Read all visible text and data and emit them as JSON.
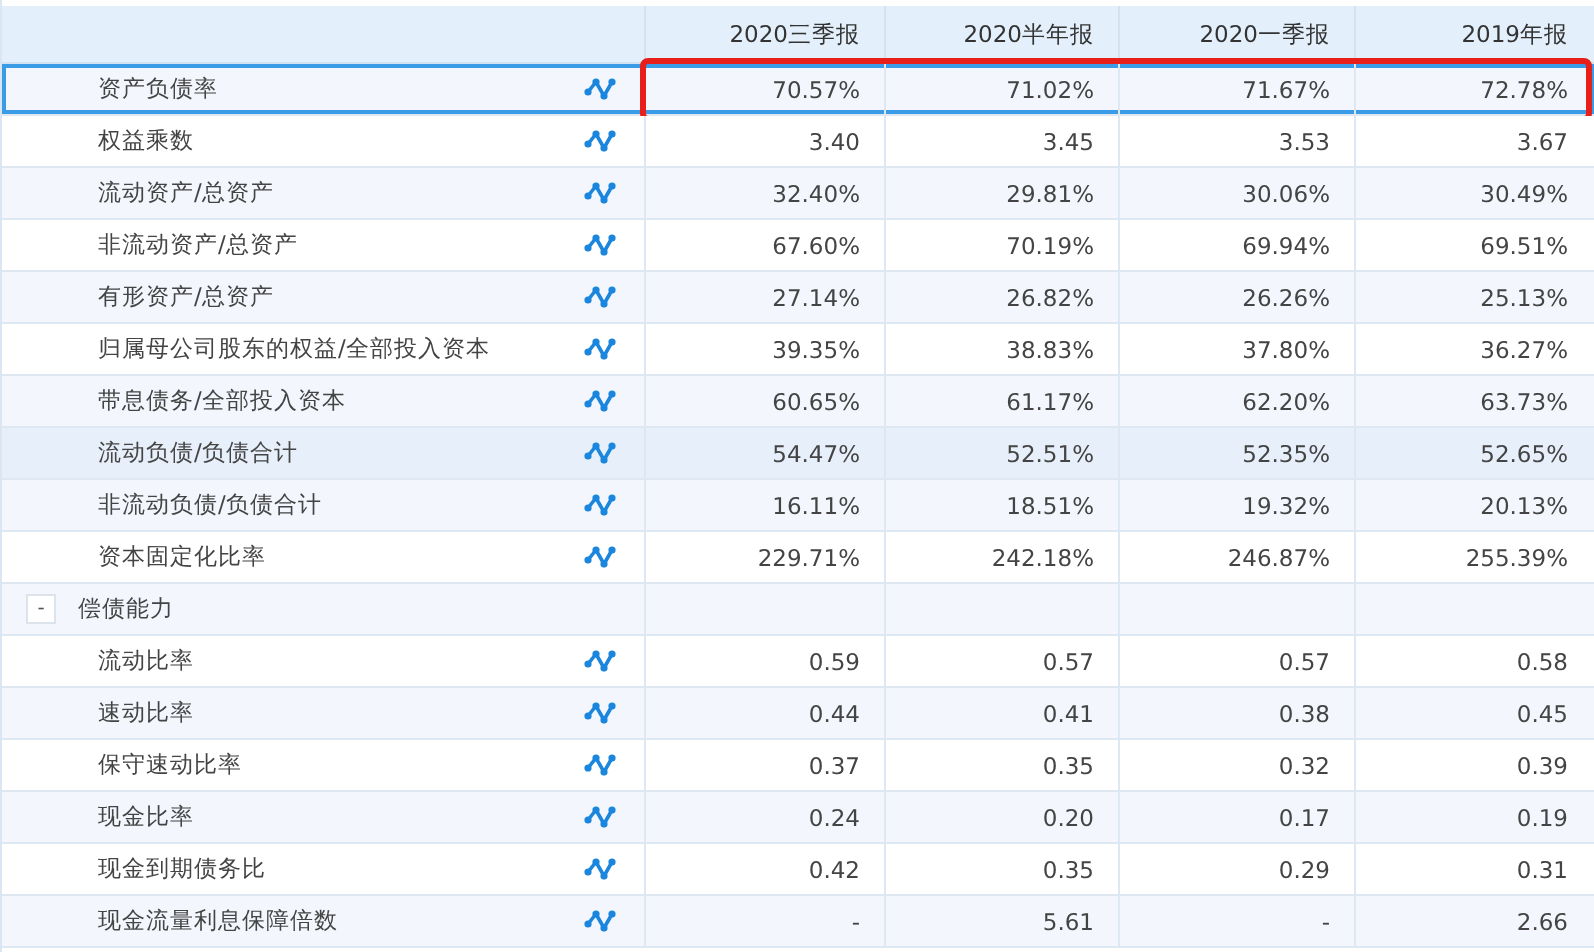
{
  "table": {
    "columns": [
      "2020三季报",
      "2020半年报",
      "2020一季报",
      "2019年报"
    ],
    "rows": [
      {
        "kind": "metric",
        "label": "资产负债率",
        "values": [
          "70.57%",
          "71.02%",
          "71.67%",
          "72.78%"
        ],
        "selected": true,
        "hovered": false,
        "boxed": true
      },
      {
        "kind": "metric",
        "label": "权益乘数",
        "values": [
          "3.40",
          "3.45",
          "3.53",
          "3.67"
        ],
        "selected": false,
        "hovered": false,
        "boxed": false
      },
      {
        "kind": "metric",
        "label": "流动资产/总资产",
        "values": [
          "32.40%",
          "29.81%",
          "30.06%",
          "30.49%"
        ],
        "selected": false,
        "hovered": false,
        "boxed": false
      },
      {
        "kind": "metric",
        "label": "非流动资产/总资产",
        "values": [
          "67.60%",
          "70.19%",
          "69.94%",
          "69.51%"
        ],
        "selected": false,
        "hovered": false,
        "boxed": false
      },
      {
        "kind": "metric",
        "label": "有形资产/总资产",
        "values": [
          "27.14%",
          "26.82%",
          "26.26%",
          "25.13%"
        ],
        "selected": false,
        "hovered": false,
        "boxed": false
      },
      {
        "kind": "metric",
        "label": "归属母公司股东的权益/全部投入资本",
        "values": [
          "39.35%",
          "38.83%",
          "37.80%",
          "36.27%"
        ],
        "selected": false,
        "hovered": false,
        "boxed": false
      },
      {
        "kind": "metric",
        "label": "带息债务/全部投入资本",
        "values": [
          "60.65%",
          "61.17%",
          "62.20%",
          "63.73%"
        ],
        "selected": false,
        "hovered": false,
        "boxed": false
      },
      {
        "kind": "metric",
        "label": "流动负债/负债合计",
        "values": [
          "54.47%",
          "52.51%",
          "52.35%",
          "52.65%"
        ],
        "selected": false,
        "hovered": true,
        "boxed": false
      },
      {
        "kind": "metric",
        "label": "非流动负债/负债合计",
        "values": [
          "16.11%",
          "18.51%",
          "19.32%",
          "20.13%"
        ],
        "selected": false,
        "hovered": false,
        "boxed": false
      },
      {
        "kind": "metric",
        "label": "资本固定化比率",
        "values": [
          "229.71%",
          "242.18%",
          "246.87%",
          "255.39%"
        ],
        "selected": false,
        "hovered": false,
        "boxed": false
      },
      {
        "kind": "group",
        "label": "偿债能力",
        "toggle": "-",
        "expanded": true
      },
      {
        "kind": "metric",
        "label": "流动比率",
        "values": [
          "0.59",
          "0.57",
          "0.57",
          "0.58"
        ],
        "selected": false,
        "hovered": false,
        "boxed": false
      },
      {
        "kind": "metric",
        "label": "速动比率",
        "values": [
          "0.44",
          "0.41",
          "0.38",
          "0.45"
        ],
        "selected": false,
        "hovered": false,
        "boxed": false
      },
      {
        "kind": "metric",
        "label": "保守速动比率",
        "values": [
          "0.37",
          "0.35",
          "0.32",
          "0.39"
        ],
        "selected": false,
        "hovered": false,
        "boxed": false
      },
      {
        "kind": "metric",
        "label": "现金比率",
        "values": [
          "0.24",
          "0.20",
          "0.17",
          "0.19"
        ],
        "selected": false,
        "hovered": false,
        "boxed": false
      },
      {
        "kind": "metric",
        "label": "现金到期债务比",
        "values": [
          "0.42",
          "0.35",
          "0.29",
          "0.31"
        ],
        "selected": false,
        "hovered": false,
        "boxed": false
      },
      {
        "kind": "metric",
        "label": "现金流量利息保障倍数",
        "values": [
          "-",
          "5.61",
          "-",
          "2.66"
        ],
        "selected": false,
        "hovered": false,
        "boxed": false
      }
    ]
  }
}
